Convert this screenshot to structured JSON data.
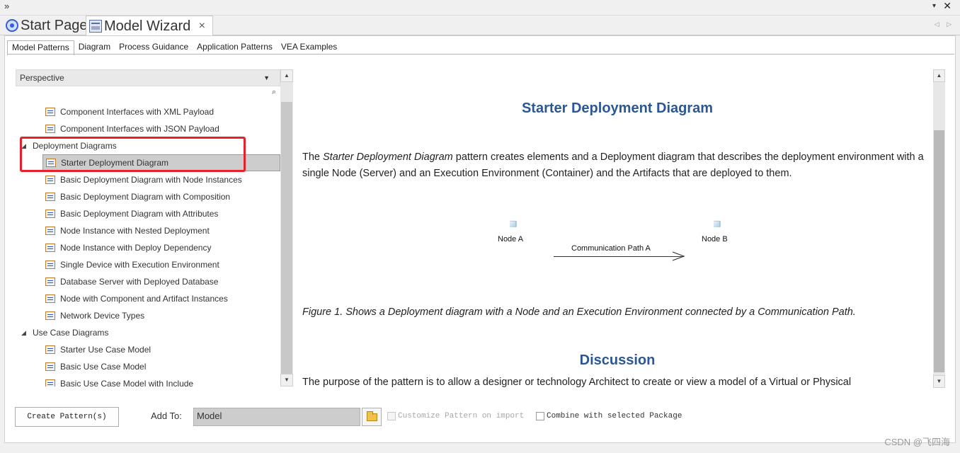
{
  "window": {
    "title_chevron": "»",
    "menu_dropdown": "▾",
    "close": "✕"
  },
  "doc_tabs": [
    {
      "label": "Start Page",
      "icon": "start-page-icon"
    },
    {
      "label": "Model Wizard",
      "icon": "model-wizard-icon",
      "close": "×",
      "active": true
    }
  ],
  "tab_nav": "◁ ▷",
  "sub_tabs": [
    "Model Patterns",
    "Diagram",
    "Process Guidance",
    "Application Patterns",
    "VEA Examples"
  ],
  "active_sub_tab": "Model Patterns",
  "perspective": {
    "label": "Perspective",
    "arrow": "▼",
    "search_icon": "⌕"
  },
  "tree": [
    {
      "type": "item",
      "label": "Component Interfaces with XML Payload"
    },
    {
      "type": "item",
      "label": "Component Interfaces with JSON Payload"
    },
    {
      "type": "group",
      "label": "Deployment Diagrams",
      "expanded": true
    },
    {
      "type": "item",
      "label": "Starter Deployment Diagram",
      "selected": true
    },
    {
      "type": "item",
      "label": "Basic Deployment Diagram with Node Instances"
    },
    {
      "type": "item",
      "label": "Basic Deployment Diagram with Composition"
    },
    {
      "type": "item",
      "label": "Basic Deployment Diagram with Attributes"
    },
    {
      "type": "item",
      "label": "Node Instance with Nested Deployment"
    },
    {
      "type": "item",
      "label": "Node Instance with Deploy Dependency"
    },
    {
      "type": "item",
      "label": "Single Device with Execution Environment"
    },
    {
      "type": "item",
      "label": "Database Server with Deployed Database"
    },
    {
      "type": "item",
      "label": "Node with Component and Artifact Instances"
    },
    {
      "type": "item",
      "label": "Network Device Types"
    },
    {
      "type": "group",
      "label": "Use Case Diagrams",
      "expanded": true
    },
    {
      "type": "item",
      "label": "Starter Use Case Model"
    },
    {
      "type": "item",
      "label": "Basic Use Case Model"
    },
    {
      "type": "item",
      "label": "Basic Use Case Model with Include"
    }
  ],
  "content": {
    "title": "Starter Deployment Diagram",
    "intro_prefix": "The ",
    "intro_em": "Starter Deployment Diagram",
    "intro_rest": " pattern creates elements and a Deployment diagram that describes the deployment environment with a single Node (Server) and an Execution Environment (Container) and the Artifacts that are deployed to them.",
    "diagram": {
      "node_a": "Node A",
      "node_b": "Node B",
      "connector": "Communication Path A"
    },
    "figure_caption": "Figure 1. Shows a Deployment diagram with a Node and an Execution Environment connected by a Communication Path.",
    "discussion_title": "Discussion",
    "discussion_text": "The purpose of the pattern is to allow a designer or technology Architect to create or view a model of a Virtual or Physical"
  },
  "bottom": {
    "create_button": "Create Pattern(s)",
    "add_to_label": "Add To:",
    "add_to_value": "Model",
    "customize_label": "Customize Pattern on import",
    "combine_label": "Combine with selected Package"
  },
  "watermark": "CSDN @飞四海",
  "colors": {
    "accent_title": "#2b5797",
    "highlight_box": "#e5222a",
    "selected_row": "#cdcdcd"
  }
}
